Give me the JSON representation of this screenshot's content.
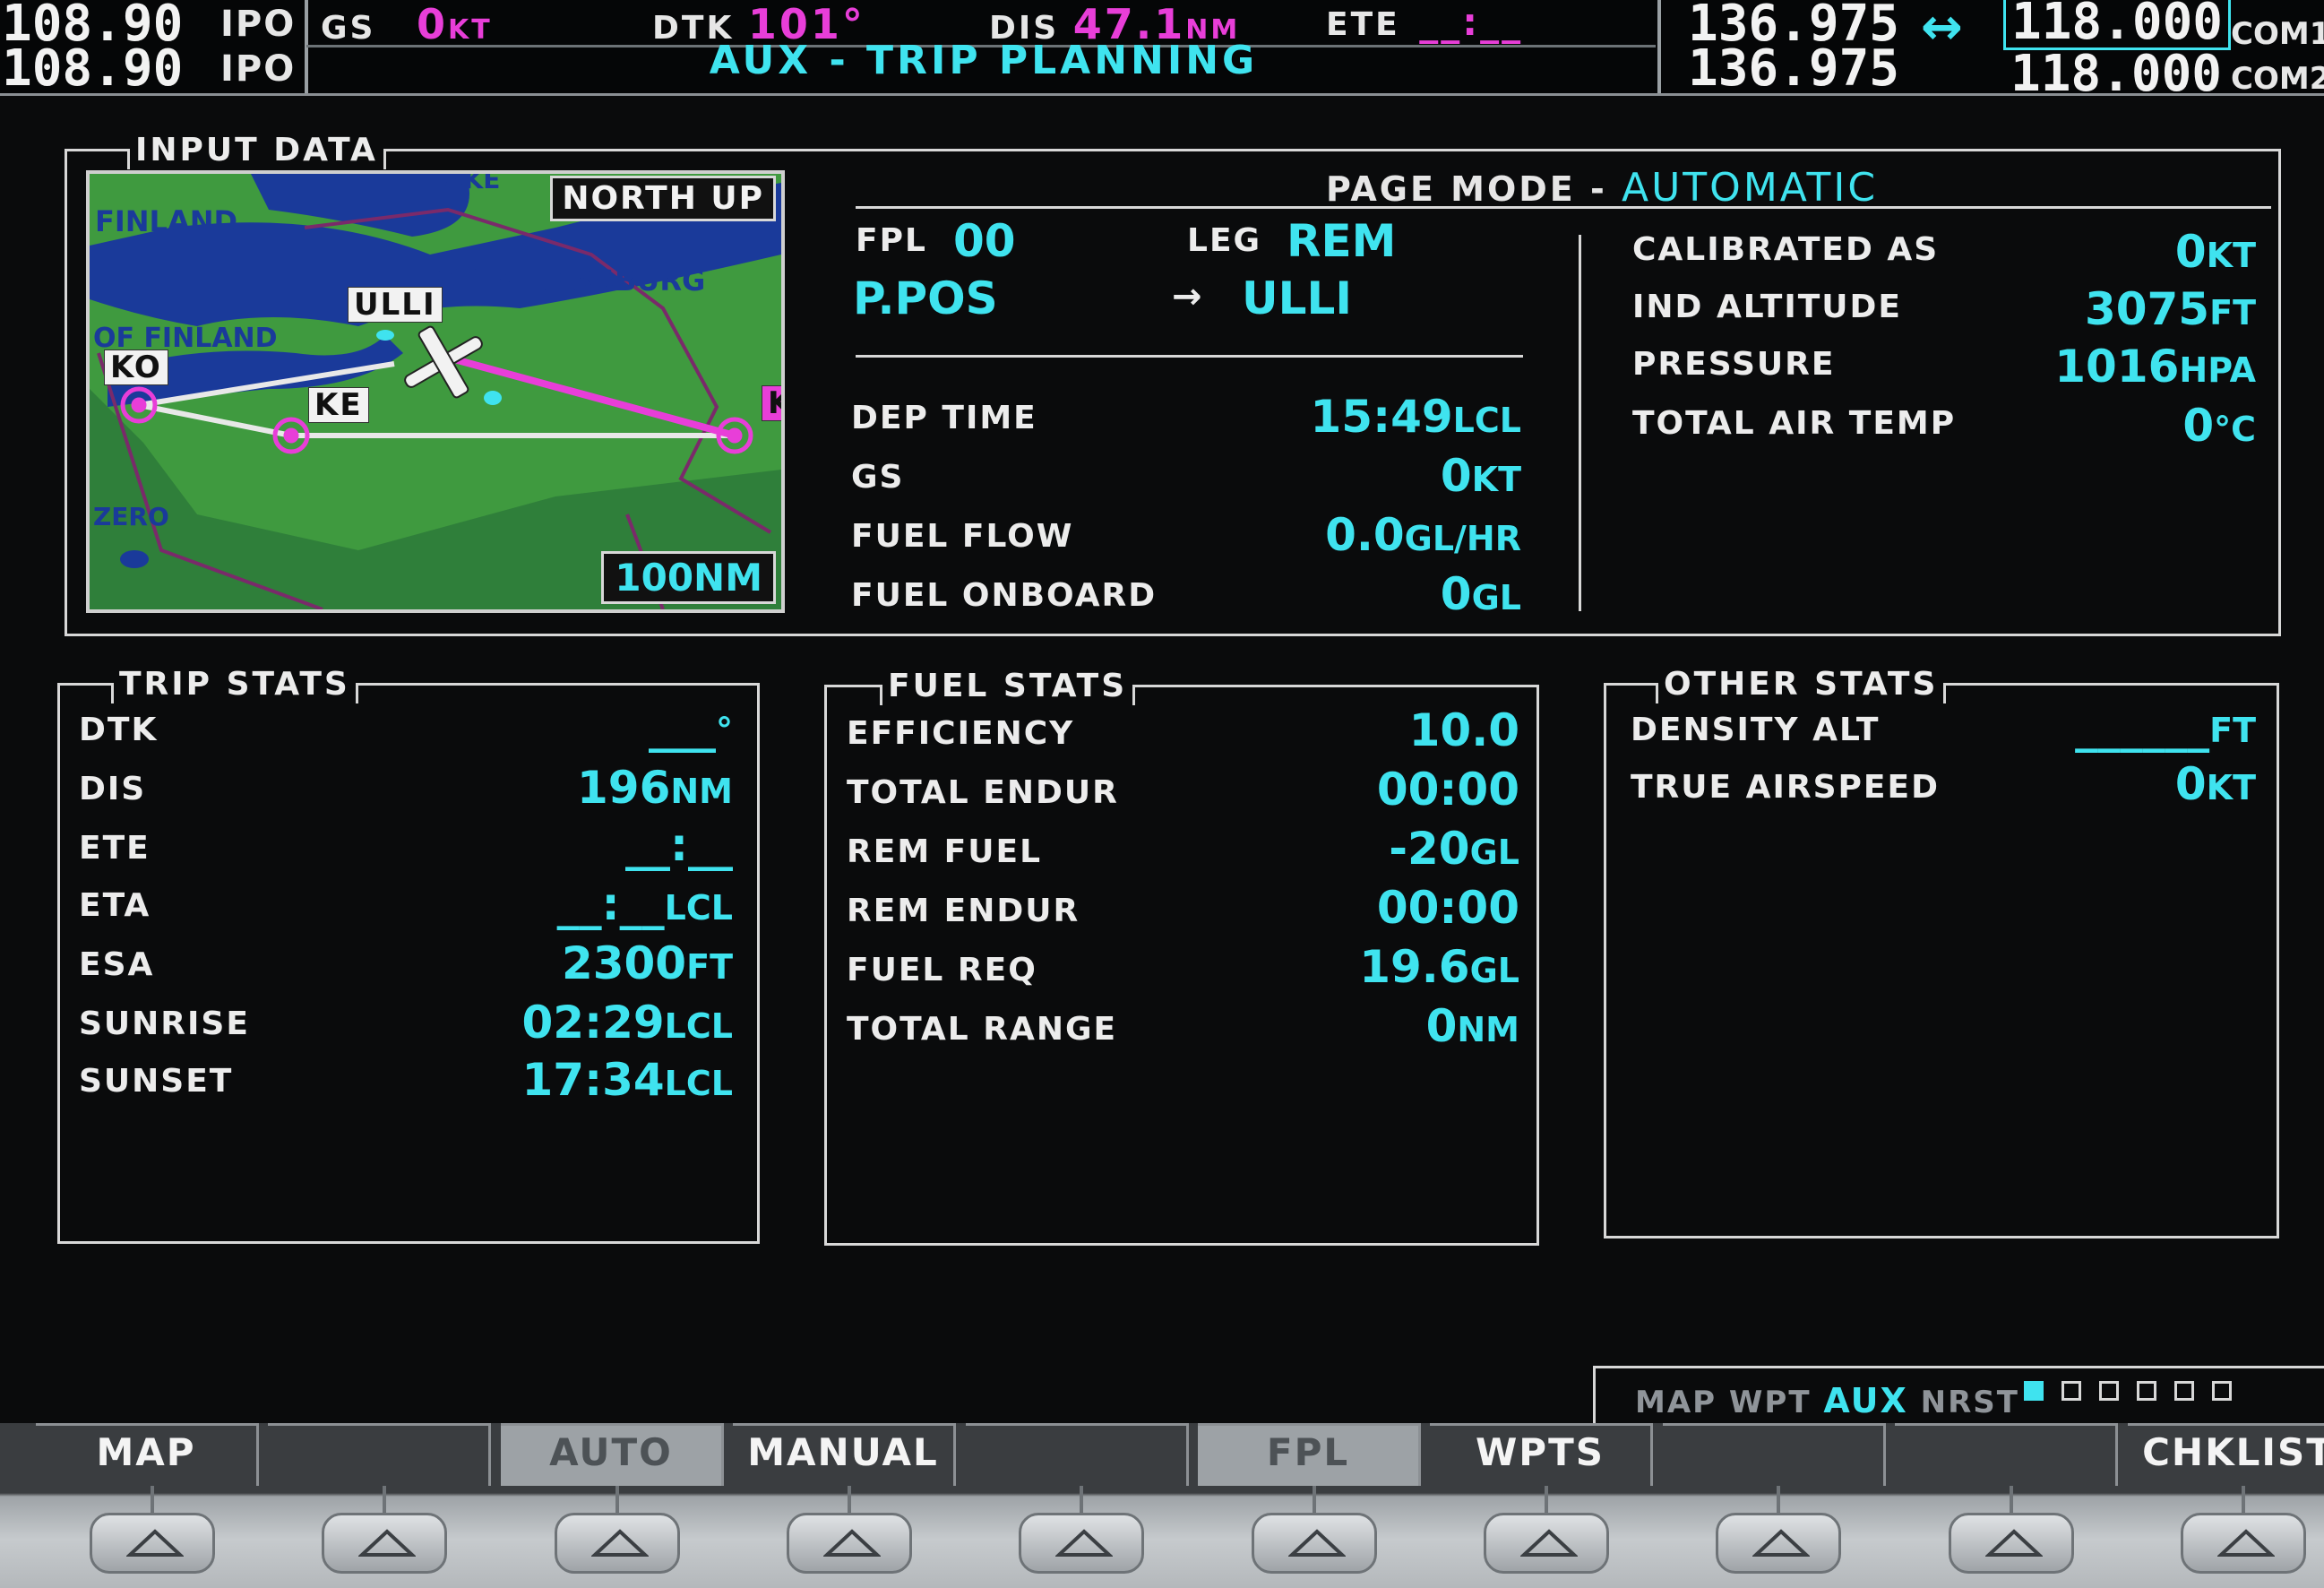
{
  "topbar": {
    "nav1_active": "108.90",
    "nav1_active_id": "IPO",
    "nav1_standby": "108.90",
    "nav1_standby_id": "IPO",
    "gs_label": "GS",
    "gs_value": "0",
    "gs_unit": "KT",
    "dtk_label": "DTK",
    "dtk_value": "101°",
    "dis_label": "DIS",
    "dis_value": "47.1",
    "dis_unit": "NM",
    "ete_label": "ETE",
    "ete_value": "__:__",
    "page_title": "AUX - TRIP PLANNING",
    "com1_standby": "136.975",
    "swap_arrow": "↔",
    "com1_active": "118.000",
    "com1_label": "COM1",
    "com2_standby": "136.975",
    "com2_active": "118.000",
    "com2_label": "COM2"
  },
  "input_data": {
    "title": "INPUT DATA",
    "map": {
      "orientation": "NORTH UP",
      "range": "100NM",
      "labels": [
        "LAKE",
        "FINLAND",
        "ST. PETERSBURG",
        "OF FINLAND",
        "ULLI",
        "KO",
        "KE",
        "ZERO",
        "K"
      ]
    },
    "page_mode_label": "PAGE MODE - ",
    "page_mode_value": "AUTOMATIC",
    "fpl_label": "FPL",
    "fpl_value": "00",
    "leg_label": "LEG",
    "leg_value": "REM",
    "from": "P.POS",
    "arrow": "→",
    "to": "ULLI",
    "rows": [
      {
        "label": "DEP TIME",
        "value": "15:49",
        "unit": "LCL"
      },
      {
        "label": "GS",
        "value": "0",
        "unit": "KT"
      },
      {
        "label": "FUEL FLOW",
        "value": "0.0",
        "unit": "GL/HR"
      },
      {
        "label": "FUEL ONBOARD",
        "value": "0",
        "unit": "GL"
      }
    ],
    "air_rows": [
      {
        "label": "CALIBRATED AS",
        "value": "0",
        "unit": "KT"
      },
      {
        "label": "IND ALTITUDE",
        "value": "3075",
        "unit": "FT"
      },
      {
        "label": "PRESSURE",
        "value": "1016",
        "unit": "HPA"
      },
      {
        "label": "TOTAL AIR TEMP",
        "value": "0",
        "unit": "°C"
      }
    ]
  },
  "trip_stats": {
    "title": "TRIP STATS",
    "rows": [
      {
        "label": "DTK",
        "value": "___",
        "unit": "°"
      },
      {
        "label": "DIS",
        "value": "196",
        "unit": "NM"
      },
      {
        "label": "ETE",
        "value": "__:__",
        "unit": ""
      },
      {
        "label": "ETA",
        "value": "__:__",
        "unit": "LCL"
      },
      {
        "label": "ESA",
        "value": "2300",
        "unit": "FT"
      },
      {
        "label": "SUNRISE",
        "value": "02:29",
        "unit": "LCL"
      },
      {
        "label": "SUNSET",
        "value": "17:34",
        "unit": "LCL"
      }
    ]
  },
  "fuel_stats": {
    "title": "FUEL STATS",
    "rows": [
      {
        "label": "EFFICIENCY",
        "value": "10.0",
        "unit": ""
      },
      {
        "label": "TOTAL ENDUR",
        "value": "00:00",
        "unit": ""
      },
      {
        "label": "REM FUEL",
        "value": "-20",
        "unit": "GL"
      },
      {
        "label": "REM ENDUR",
        "value": "00:00",
        "unit": ""
      },
      {
        "label": "FUEL REQ",
        "value": "19.6",
        "unit": "GL"
      },
      {
        "label": "TOTAL RANGE",
        "value": "0",
        "unit": "NM"
      }
    ]
  },
  "other_stats": {
    "title": "OTHER STATS",
    "rows": [
      {
        "label": "DENSITY ALT",
        "value": "______",
        "unit": "FT"
      },
      {
        "label": "TRUE AIRSPEED",
        "value": "0",
        "unit": "KT"
      }
    ]
  },
  "page_group": {
    "items": [
      "MAP",
      "WPT",
      "AUX",
      "NRST"
    ],
    "active": "AUX",
    "page_count": 6,
    "active_page": 1
  },
  "softkeys": [
    {
      "label": "MAP",
      "state": "normal"
    },
    {
      "label": "",
      "state": "normal"
    },
    {
      "label": "AUTO",
      "state": "dim"
    },
    {
      "label": "MANUAL",
      "state": "normal"
    },
    {
      "label": "",
      "state": "normal"
    },
    {
      "label": "FPL",
      "state": "dim"
    },
    {
      "label": "WPTS",
      "state": "normal"
    },
    {
      "label": "",
      "state": "normal"
    },
    {
      "label": "",
      "state": "normal"
    },
    {
      "label": "CHKLIST",
      "state": "normal"
    }
  ],
  "colors": {
    "background": "#0a0b0c",
    "text": "#ececec",
    "value": "#3fe3ef",
    "nav_data": "#e83ed8",
    "map_land": "#3f9a3f",
    "map_water": "#1a3a9a",
    "route_active": "#e83ed8",
    "route": "#e8e8e8"
  }
}
